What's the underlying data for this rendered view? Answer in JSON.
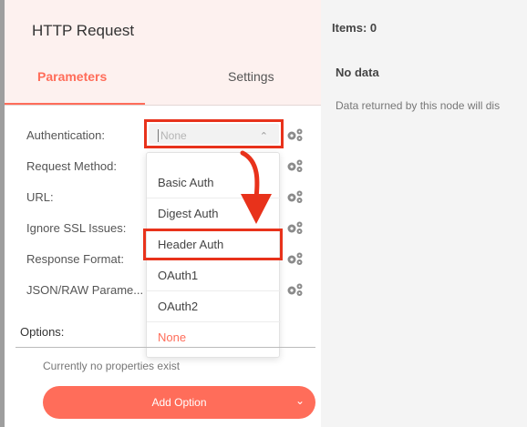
{
  "node": {
    "title": "HTTP Request"
  },
  "tabs": [
    {
      "label": "Parameters",
      "active": true
    },
    {
      "label": "Settings",
      "active": false
    }
  ],
  "parameters": {
    "authentication": {
      "label": "Authentication:",
      "value": "None"
    },
    "request_method": {
      "label": "Request Method:"
    },
    "url": {
      "label": "URL:"
    },
    "ignore_ssl": {
      "label": "Ignore SSL Issues:"
    },
    "response_format": {
      "label": "Response Format:"
    },
    "json_raw": {
      "label": "JSON/RAW Parame..."
    }
  },
  "auth_dropdown": {
    "options": [
      "Basic Auth",
      "Digest Auth",
      "Header Auth",
      "OAuth1",
      "OAuth2",
      "None"
    ],
    "highlighted": "Header Auth"
  },
  "options": {
    "label": "Options:",
    "empty_text": "Currently no properties exist",
    "add_button_label": "Add Option"
  },
  "output": {
    "items_label": "Items: 0",
    "no_data_title": "No data",
    "no_data_text": "Data returned by this node will dis"
  },
  "colors": {
    "accent": "#ff6d5a",
    "highlight_box": "#e8321b",
    "header_bg": "#fdf1ef"
  },
  "icons": {
    "gear": "gears-icon",
    "chevron_up": "chevron-up-icon",
    "chevron_down": "chevron-down-icon",
    "annotation_arrow": "arrow-down-icon"
  }
}
